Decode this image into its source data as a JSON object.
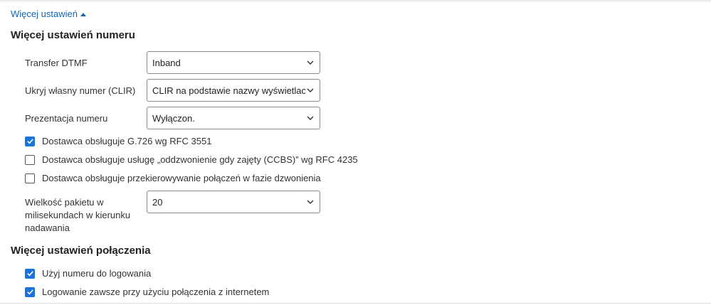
{
  "toggle": {
    "label": "Więcej ustawień"
  },
  "sections": {
    "number": {
      "title": "Więcej ustawień numeru"
    },
    "connection": {
      "title": "Więcej ustawień połączenia"
    }
  },
  "fields": {
    "dtmf": {
      "label": "Transfer DTMF",
      "value": "Inband"
    },
    "clir": {
      "label": "Ukryj własny numer (CLIR)",
      "value": "CLIR na podstawie nazwy wyświetlacza"
    },
    "presentation": {
      "label": "Prezentacja numeru",
      "value": "Wyłączon."
    },
    "packet": {
      "label_lines": [
        "Wielkość pakietu w",
        "milisekundach w kierunku",
        "nadawania"
      ],
      "value": "20"
    }
  },
  "checkboxes": [
    {
      "label": "Dostawca obsługuje G.726 wg RFC 3551",
      "checked": true
    },
    {
      "label": "Dostawca obsługuje usługę „oddzwonienie gdy zajęty (CCBS)” wg RFC 4235",
      "checked": false
    },
    {
      "label": "Dostawca obsługuje przekierowywanie połączeń w fazie dzwonienia",
      "checked": false
    },
    {
      "label": "Użyj numeru do logowania",
      "checked": true
    },
    {
      "label": "Logowanie zawsze przy użyciu połączenia z internetem",
      "checked": true
    }
  ],
  "colors": {
    "link": "#1566b8",
    "checkbox_checked": "#1a73d9"
  },
  "icons": {
    "toggle": "caret-up-icon",
    "select": "chevron-down-icon",
    "check": "checkmark-icon"
  }
}
